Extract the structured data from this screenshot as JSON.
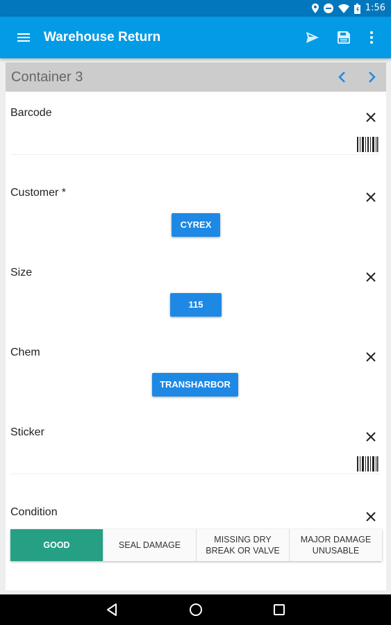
{
  "status_bar": {
    "time": "1:56",
    "icons": [
      "location-icon",
      "do-not-disturb-icon",
      "wifi-icon",
      "battery-icon"
    ]
  },
  "app_bar": {
    "title": "Warehouse Return",
    "icons": [
      "menu-icon",
      "send-icon",
      "save-icon",
      "more-vert-icon"
    ],
    "color": "#039be5"
  },
  "container": {
    "title": "Container 3",
    "nav_icons": [
      "chevron-left-icon",
      "chevron-right-icon"
    ]
  },
  "fields": {
    "barcode": {
      "label": "Barcode"
    },
    "customer": {
      "label": "Customer *",
      "value": "CYREX"
    },
    "size": {
      "label": "Size",
      "value": "115"
    },
    "chem": {
      "label": "Chem",
      "value": "TRANSHARBOR"
    },
    "sticker": {
      "label": "Sticker"
    },
    "condition": {
      "label": "Condition",
      "options": [
        "GOOD",
        "SEAL DAMAGE",
        "MISSING DRY BREAK OR VALVE",
        "MAJOR DAMAGE UNUSABLE"
      ],
      "selected": "GOOD",
      "selected_color": "#26a085"
    }
  },
  "nav_bar": {
    "icons": [
      "back-icon",
      "home-icon",
      "recents-icon"
    ]
  }
}
